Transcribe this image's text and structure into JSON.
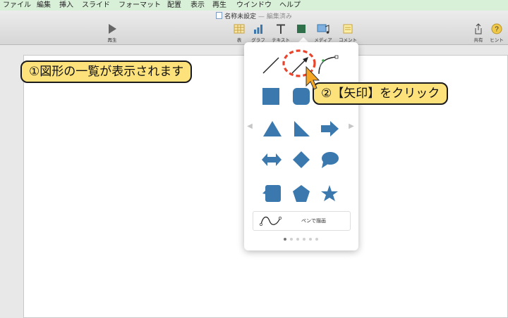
{
  "menubar": {
    "items": [
      "ファイル",
      "編集",
      "挿入",
      "スライド",
      "フォーマット",
      "配置",
      "表示",
      "再生",
      "ウインドウ",
      "ヘルプ"
    ]
  },
  "window": {
    "doc_title": "名称未設定",
    "doc_status": "— 編集済み"
  },
  "toolbar": {
    "play_label": "再生",
    "table_label": "表",
    "chart_label": "グラフ",
    "text_label": "テキスト",
    "shape_label": "図形",
    "media_label": "メディア",
    "comment_label": "コメント",
    "share_label": "共有",
    "tips_label": "ヒント"
  },
  "shape_popover": {
    "pen_label": "ペンで描画",
    "page_count": 6,
    "current_page": 1,
    "shape_color": "#3a78ad"
  },
  "annotations": {
    "step1": "①図形の一覧が表示されます",
    "step2": "②【矢印】をクリック",
    "highlight_color": "#e8452c",
    "callout_color": "#fde27c"
  }
}
